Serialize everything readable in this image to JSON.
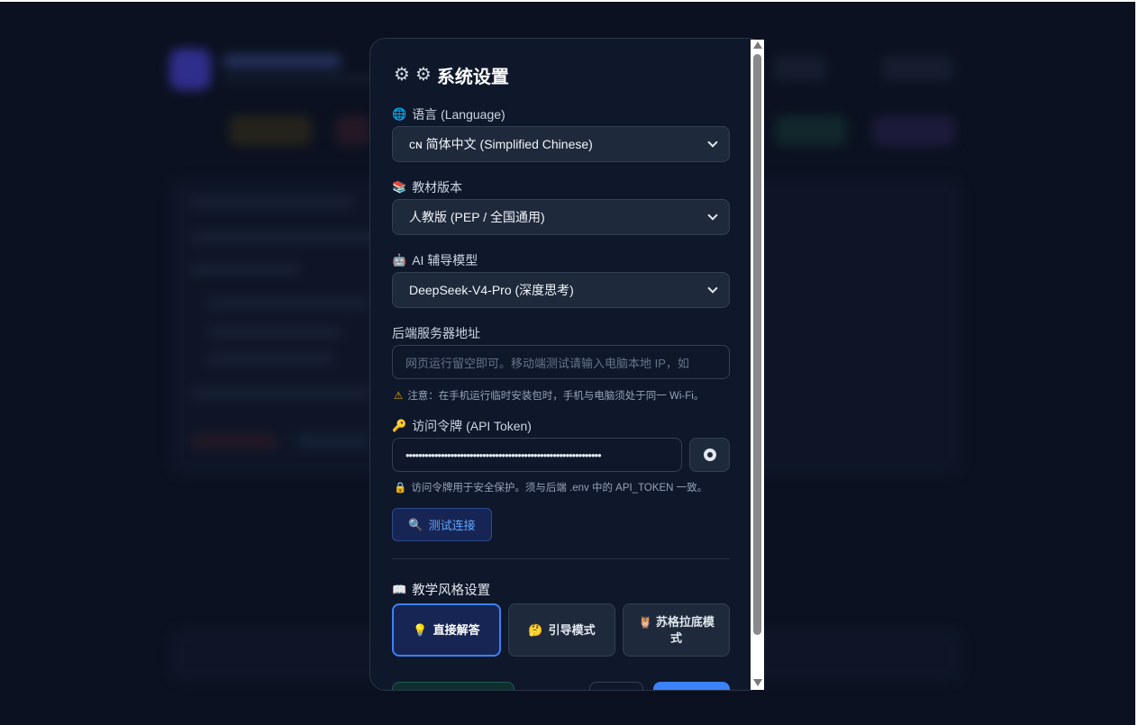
{
  "modal": {
    "title": "系统设置",
    "title_icons": [
      "gear-icon",
      "gear-icon"
    ],
    "language": {
      "label": "语言 (Language)",
      "icon": "globe-icon",
      "selected": "简体中文 (Simplified Chinese)",
      "selected_prefix": "ᴄɴ"
    },
    "textbook": {
      "label": "教材版本",
      "icon": "books-icon",
      "selected": "人教版 (PEP / 全国通用)"
    },
    "ai_model": {
      "label": "AI 辅导模型",
      "icon": "robot-icon",
      "selected": "DeepSeek-V4-Pro (深度思考)"
    },
    "server": {
      "label": "后端服务器地址",
      "placeholder": "网页运行留空即可。移动端测试请输入电脑本地 IP，如",
      "note": "注意：在手机运行临时安装包时，手机与电脑须处于同一 Wi-Fi。"
    },
    "token": {
      "label": "访问令牌 (API Token)",
      "icon": "key-icon",
      "masked_value": "•••••••••••••••••••••••••••••••••••••••••••••••••••••••••••••",
      "note": "访问令牌用于安全保护。须与后端 .env 中的 API_TOKEN 一致。"
    },
    "test_button": "测试连接",
    "teaching_style": {
      "label": "教学风格设置",
      "icon": "book-icon",
      "options": [
        {
          "label": "直接解答",
          "icon": "bulb-icon",
          "active": true
        },
        {
          "label": "引导模式",
          "icon": "thinking-icon",
          "active": false
        },
        {
          "label": "苏格拉底模式",
          "icon": "owl-icon",
          "active": false
        }
      ]
    }
  },
  "colors": {
    "accent": "#3b82f6",
    "modal_bg": "#0f172a",
    "field_bg": "#1e293b",
    "page_bg": "#0b1120"
  }
}
